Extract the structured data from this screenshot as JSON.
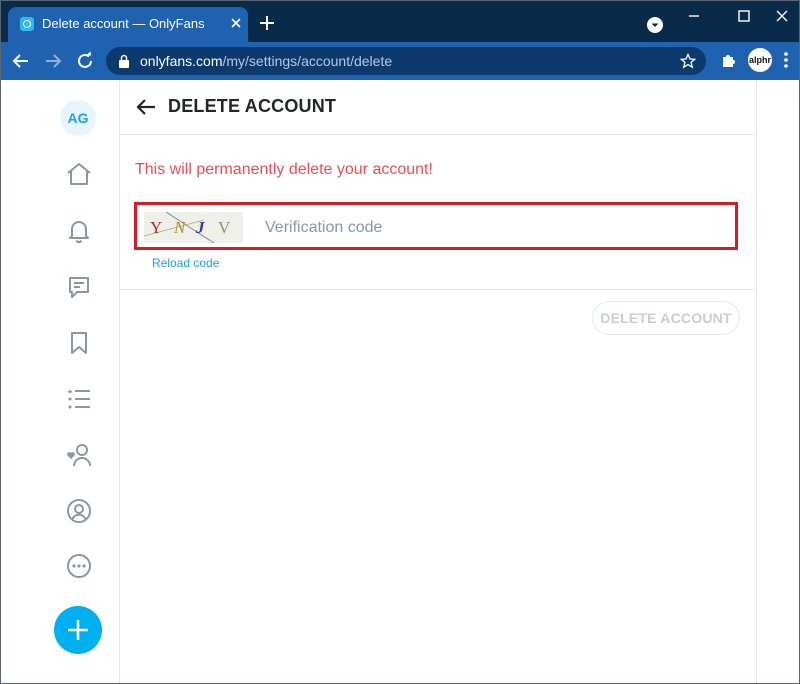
{
  "browser": {
    "tab_title": "Delete account — OnlyFans",
    "url_host": "onlyfans.com",
    "url_path": "/my/settings/account/delete",
    "profile_label": "alphr"
  },
  "sidebar": {
    "avatar_initials": "AG",
    "icons": [
      "home-icon",
      "bell-icon",
      "messages-icon",
      "bookmark-icon",
      "lists-icon",
      "subscriptions-icon",
      "profile-icon",
      "more-icon"
    ]
  },
  "page": {
    "title": "DELETE ACCOUNT",
    "warning": "This will permanently delete your account!",
    "captcha_chars": [
      "Y",
      "N",
      "J",
      "V"
    ],
    "code_placeholder": "Verification code",
    "reload_label": "Reload code",
    "delete_button_label": "DELETE ACCOUNT"
  },
  "colors": {
    "brand": "#00aff0",
    "warning": "#ef4b55",
    "highlight_border": "#d61c24",
    "chrome_tab": "#1f62b0",
    "chrome_titlebar": "#0a2a4a"
  }
}
